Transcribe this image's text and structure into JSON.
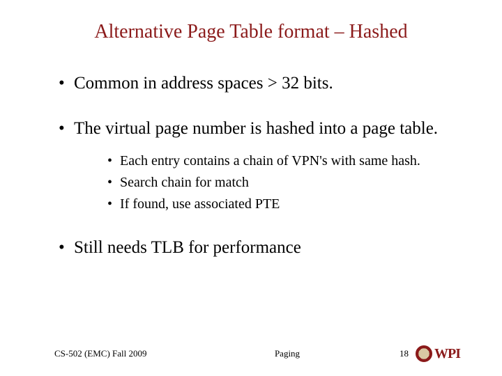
{
  "title": "Alternative Page Table format – Hashed",
  "bullets": {
    "b1": "Common in address spaces > 32 bits.",
    "b2": "The virtual page number is hashed into a page table.",
    "b2_sub": {
      "s1": "Each entry contains a chain of VPN's with same hash.",
      "s2": "Search chain for match",
      "s3": "If found, use associated PTE"
    },
    "b3": "Still needs TLB for performance"
  },
  "footer": {
    "left": "CS-502 (EMC) Fall 2009",
    "center": "Paging",
    "page": "18",
    "logo_text": "WPI"
  }
}
